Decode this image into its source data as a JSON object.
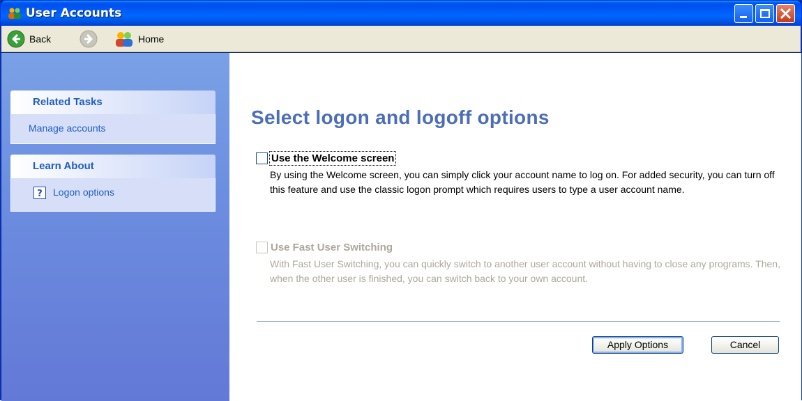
{
  "window": {
    "title": "User Accounts",
    "icon": "user-accounts-icon"
  },
  "toolbar": {
    "back_label": "Back",
    "forward_icon": "forward-arrow-icon",
    "home_label": "Home"
  },
  "sidebar": {
    "related_tasks": {
      "heading": "Related Tasks",
      "items": [
        {
          "label": "Manage accounts"
        }
      ]
    },
    "learn_about": {
      "heading": "Learn About",
      "items": [
        {
          "label": "Logon options",
          "icon": "help-icon"
        }
      ]
    }
  },
  "main": {
    "title": "Select logon and logoff options",
    "options": [
      {
        "label": "Use the Welcome screen",
        "checked": false,
        "enabled": true,
        "description": "By using the Welcome screen, you can simply click your account name to log on. For added security, you can turn off this feature and use the classic logon prompt which requires users to type a user account name."
      },
      {
        "label": "Use Fast User Switching",
        "checked": false,
        "enabled": false,
        "description": "With Fast User Switching, you can quickly switch to another user account without having to close any programs. Then, when the other user is finished, you can switch back to your own account."
      }
    ],
    "buttons": {
      "apply": "Apply Options",
      "cancel": "Cancel"
    }
  },
  "colors": {
    "title_bar": "#0053ee",
    "task_pane": "#6c8ee0",
    "page_title": "#4c6eb8",
    "panel_heading": "#215dc6"
  }
}
